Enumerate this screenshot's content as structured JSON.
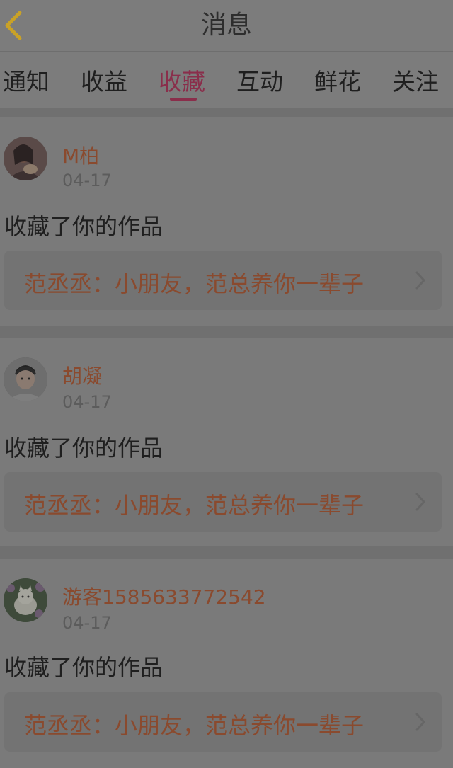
{
  "header": {
    "title": "消息",
    "back_icon": "chevron-left-icon",
    "accent_color": "#c9a227"
  },
  "tabs": [
    {
      "label": "通知",
      "active": false
    },
    {
      "label": "收益",
      "active": false
    },
    {
      "label": "收藏",
      "active": true
    },
    {
      "label": "互动",
      "active": false
    },
    {
      "label": "鲜花",
      "active": false
    },
    {
      "label": "关注",
      "active": false
    }
  ],
  "active_tab_color": "#8a2e4b",
  "messages": [
    {
      "username": "M柏",
      "date": "04-17",
      "action": "收藏了你的作品",
      "work_title": "范丞丞：小朋友，范总养你一辈子"
    },
    {
      "username": "胡凝",
      "date": "04-17",
      "action": "收藏了你的作品",
      "work_title": "范丞丞：小朋友，范总养你一辈子"
    },
    {
      "username": "游客1585633772542",
      "date": "04-17",
      "action": "收藏了你的作品",
      "work_title": "范丞丞：小朋友，范总养你一辈子"
    }
  ]
}
